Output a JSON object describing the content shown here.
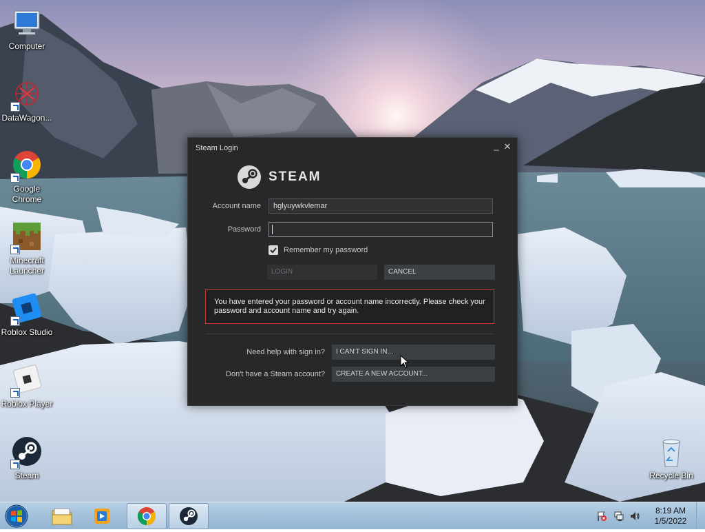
{
  "desktop": {
    "icons": [
      {
        "label": "Computer",
        "icon": "computer-icon"
      },
      {
        "label": "DataWagon...",
        "icon": "datawagon-icon"
      },
      {
        "label": "Google Chrome",
        "icon": "chrome-icon"
      },
      {
        "label": "Minecraft Launcher",
        "icon": "minecraft-icon"
      },
      {
        "label": "Roblox Studio",
        "icon": "roblox-studio-icon"
      },
      {
        "label": "Roblox Player",
        "icon": "roblox-player-icon"
      },
      {
        "label": "Steam",
        "icon": "steam-icon"
      },
      {
        "label": "Recycle Bin",
        "icon": "recycle-bin-icon"
      }
    ]
  },
  "steam_login": {
    "window_title": "Steam Login",
    "minimize": "_",
    "close": "✕",
    "logo_text": "STEAM",
    "account_label": "Account name",
    "account_value": "hglyuywkvlemar",
    "password_label": "Password",
    "password_value": "",
    "remember_label": "Remember my password",
    "remember_checked": true,
    "login_button": "LOGIN",
    "cancel_button": "CANCEL",
    "error_message": "You have entered your password or account name incorrectly. Please check your password and account name and try again.",
    "help_label": "Need help with sign in?",
    "cant_sign_in_button": "I CAN'T SIGN IN...",
    "no_account_label": "Don't have a Steam account?",
    "create_account_button": "CREATE A NEW ACCOUNT..."
  },
  "taskbar": {
    "pinned": [
      "file-explorer-icon",
      "media-player-icon",
      "chrome-icon",
      "steam-icon"
    ],
    "active": "steam-icon",
    "tray": [
      "action-center-flag-icon",
      "network-icon",
      "volume-icon"
    ],
    "time": "8:19 AM",
    "date": "1/5/2022"
  },
  "colors": {
    "steam_bg": "#262829",
    "error_border": "#c0392b",
    "taskbar": "#a5c2dc"
  }
}
